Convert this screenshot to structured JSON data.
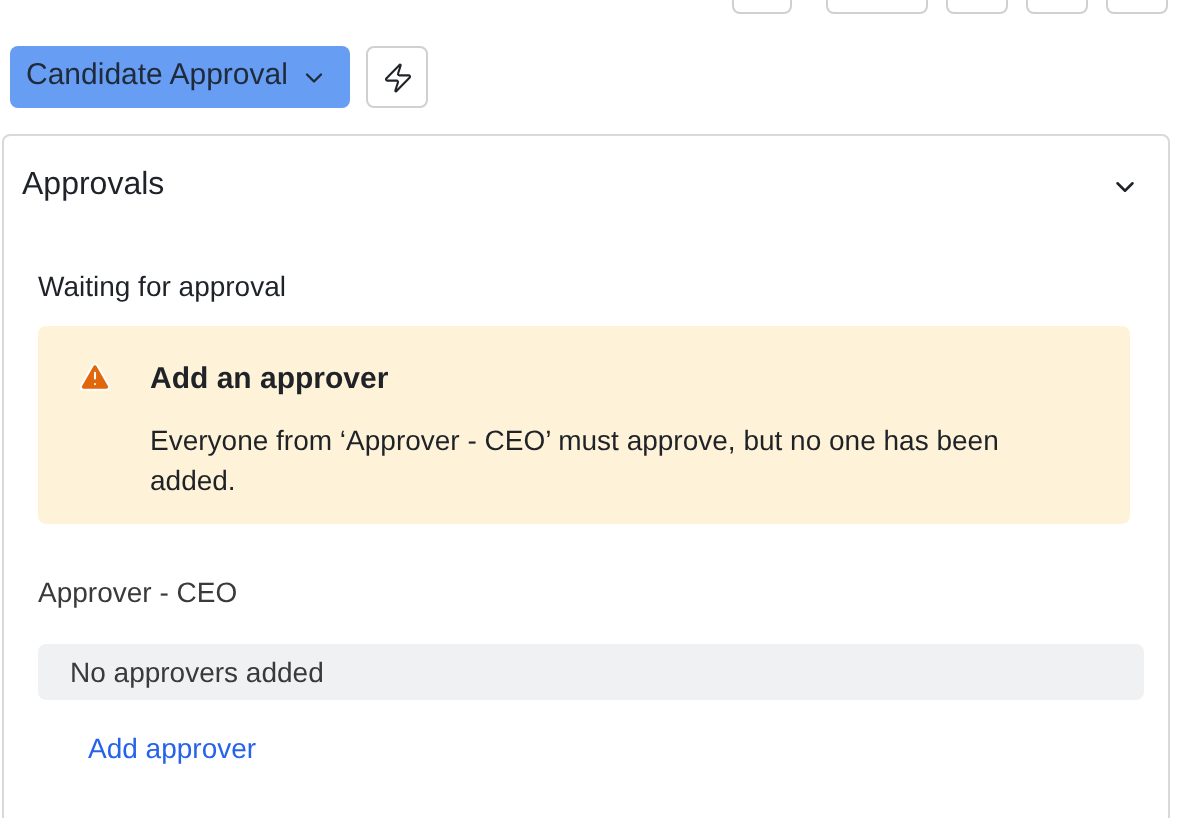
{
  "toolbar": {
    "workflow_button": "Candidate Approval"
  },
  "panel": {
    "title": "Approvals",
    "expanded": true,
    "status": "Waiting for approval",
    "alert": {
      "title": "Add an approver",
      "message": "Everyone from ‘Approver - CEO’ must approve, but no one has been added."
    },
    "groups": [
      {
        "name": "Approver - CEO",
        "empty_text": "No approvers added",
        "action": "Add approver"
      }
    ]
  }
}
